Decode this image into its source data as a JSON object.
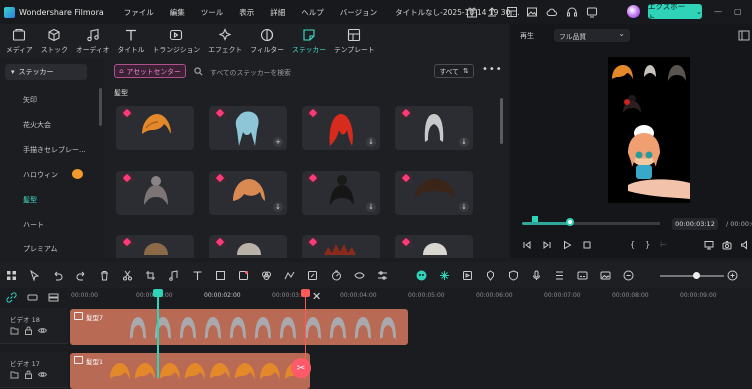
{
  "app": {
    "name": "Wondershare Filmora",
    "doc_title": "タイトルなし-2025-10-14 19 30 ..."
  },
  "menu": [
    "ファイル",
    "編集",
    "ツール",
    "表示",
    "詳細",
    "ヘルプ",
    "バージョン"
  ],
  "export_label": "エクスポート",
  "toolbar": [
    {
      "label": "メディア",
      "icon": "media-icon"
    },
    {
      "label": "ストック",
      "icon": "stock-icon"
    },
    {
      "label": "オーディオ",
      "icon": "audio-icon"
    },
    {
      "label": "タイトル",
      "icon": "title-icon"
    },
    {
      "label": "トランジション",
      "icon": "transition-icon"
    },
    {
      "label": "エフェクト",
      "icon": "effect-icon"
    },
    {
      "label": "フィルター",
      "icon": "filter-icon"
    },
    {
      "label": "ステッカー",
      "icon": "sticker-icon",
      "active": true
    },
    {
      "label": "テンプレート",
      "icon": "template-icon"
    }
  ],
  "sidebar": {
    "header": "ステッカー",
    "items": [
      "矢印",
      "花火大会",
      "手描きセレブレー...",
      "ハロウィン",
      "髪型",
      "ハート",
      "プレミアム"
    ],
    "active_item": "髪型"
  },
  "library": {
    "asset_center": "アセットセンター",
    "search_placeholder": "すべてのステッカーを検索",
    "filter_label": "すべて",
    "section_title": "髪型",
    "cards": [
      {
        "hair": "orange-short"
      },
      {
        "hair": "blue-twintails",
        "action": "+"
      },
      {
        "hair": "red-long"
      },
      {
        "hair": "silver-long"
      },
      {
        "hair": "grey-bun"
      },
      {
        "hair": "orange-bob"
      },
      {
        "hair": "black-bun"
      },
      {
        "hair": "brown-curly"
      },
      {
        "hair": "brown"
      },
      {
        "hair": "grey"
      },
      {
        "hair": "red-spiky"
      },
      {
        "hair": "white"
      }
    ]
  },
  "preview": {
    "label": "再生",
    "quality": "フル品質",
    "timecode": "00:00:03:12",
    "total": "/ 00:00:0"
  },
  "timeline": {
    "ruler": [
      "00:00:00",
      "00:00:01:00",
      "00:00:02:00",
      "00:00:03:00",
      "00:00:04:00",
      "00:00:05:00",
      "00:00:06:00",
      "00:00:07:00",
      "00:00:08:00",
      "00:00:09:00"
    ],
    "tracks": [
      {
        "name": "ビデオ 18",
        "clip": "髪型7"
      },
      {
        "name": "ビデオ 17",
        "clip": "髪型1"
      }
    ]
  },
  "colors": {
    "accent": "#2fd3b8",
    "clip": "#c06a4f",
    "marker": "#ff5a5a"
  }
}
